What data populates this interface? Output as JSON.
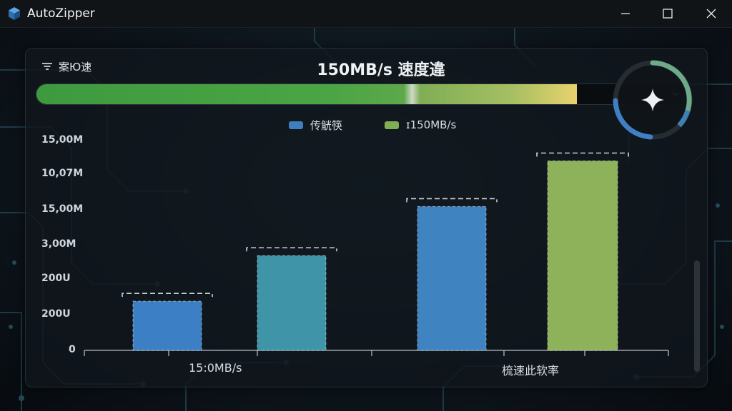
{
  "window": {
    "title": "AutoZipper"
  },
  "header": {
    "filter_label": "案Ю速",
    "speed_title": "150MB/s 速度違"
  },
  "progress": {
    "fraction": 0.835
  },
  "legend": [
    {
      "label": "传觥筷",
      "color": "#3f7fc0"
    },
    {
      "label": "ɪ150MB/s",
      "color": "#7fae55"
    }
  ],
  "chart_data": {
    "type": "bar",
    "y_tick_labels": [
      "15,00M",
      "10,07M",
      "15,00M",
      "3,00M",
      "200U",
      "200U",
      "0"
    ],
    "x_tick_labels": [
      "15:0MB/s",
      "梳速此软率"
    ],
    "ylim": [
      0,
      6
    ],
    "values": [
      1.4,
      2.7,
      4.1,
      5.4
    ],
    "bar_colors": [
      "#3d7fc4",
      "#3f94a8",
      "#3f84c0",
      "#8eb25a"
    ],
    "grid": false,
    "legend_position": "top-center"
  },
  "icons": {
    "app": "autozipper-cube-icon",
    "filter": "filter-lines-icon",
    "ring_center": "sparkle-icon",
    "dropdown": "chevron-down-icon",
    "minimize": "minimize-icon",
    "maximize": "maximize-icon",
    "close": "close-icon"
  }
}
